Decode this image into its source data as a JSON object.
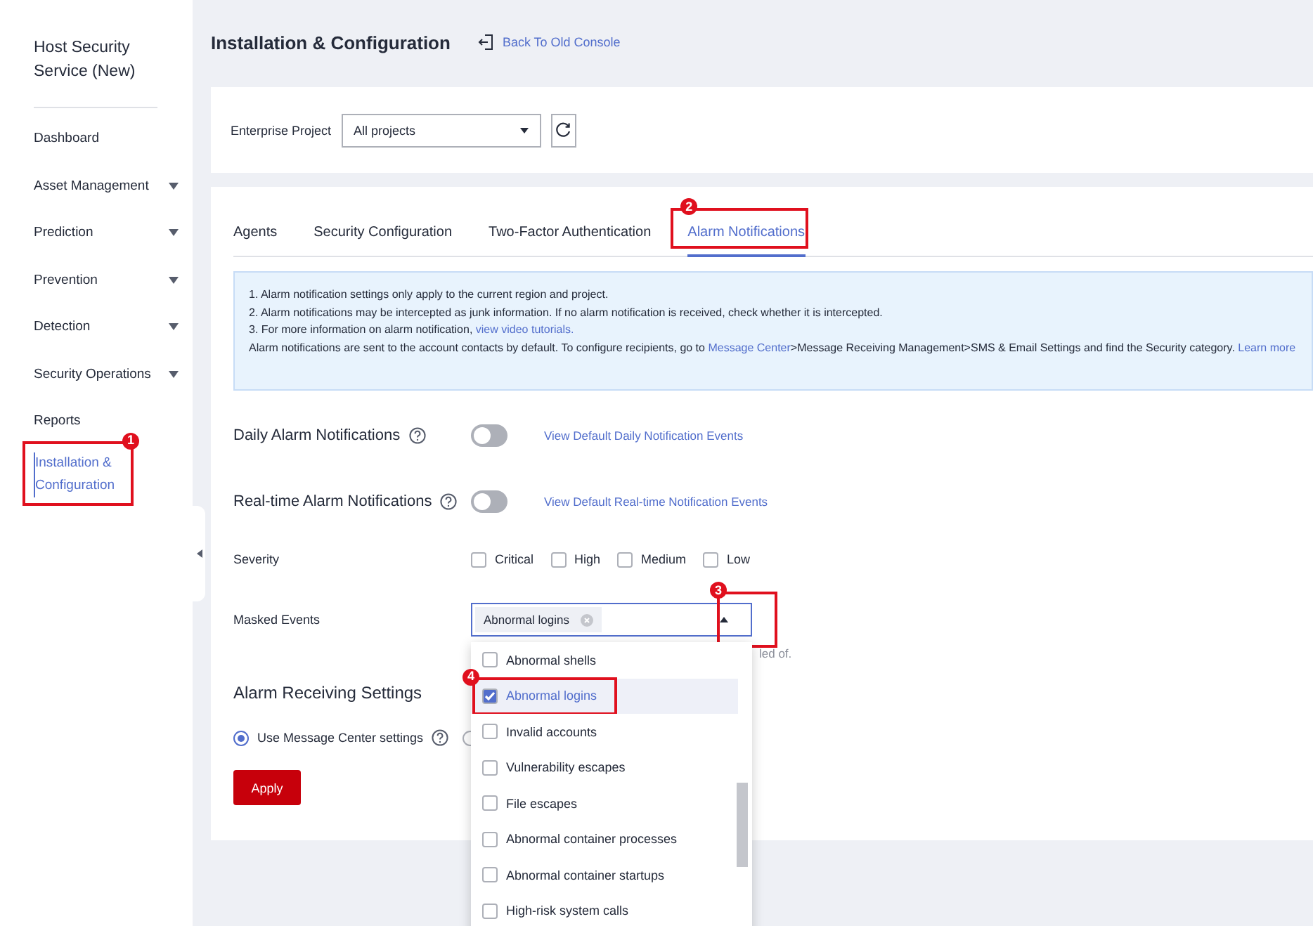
{
  "sidebar": {
    "title": "Host Security Service (New)",
    "items": [
      {
        "label": "Dashboard",
        "expandable": false,
        "selected": false
      },
      {
        "label": "Asset Management",
        "expandable": true,
        "selected": false
      },
      {
        "label": "Prediction",
        "expandable": true,
        "selected": false
      },
      {
        "label": "Prevention",
        "expandable": true,
        "selected": false
      },
      {
        "label": "Detection",
        "expandable": true,
        "selected": false
      },
      {
        "label": "Security Operations",
        "expandable": true,
        "selected": false
      },
      {
        "label": "Reports",
        "expandable": false,
        "selected": false
      },
      {
        "label": "Installation & Configuration",
        "expandable": false,
        "selected": true,
        "callout": "1"
      }
    ]
  },
  "header": {
    "title": "Installation & Configuration",
    "back_link": "Back To Old Console"
  },
  "project": {
    "label": "Enterprise Project",
    "value": "All projects"
  },
  "tabs": [
    {
      "label": "Agents",
      "selected": false
    },
    {
      "label": "Security Configuration",
      "selected": false
    },
    {
      "label": "Two-Factor Authentication",
      "selected": false
    },
    {
      "label": "Alarm Notifications",
      "selected": true,
      "callout": "2"
    }
  ],
  "notice": [
    {
      "text": "1. Alarm notification settings only apply to the current region and project."
    },
    {
      "text": "2. Alarm notifications may be intercepted as junk information. If no alarm notification is received, check whether it is intercepted."
    },
    {
      "text": "3. For more information on alarm notification, ",
      "link": "view video tutorials."
    },
    {
      "text": "Alarm notifications are sent to the account contacts by default. To configure recipients, go to ",
      "link": "Message Center",
      "after": ">Message Receiving Management>SMS & Email Settings and find the Security category. ",
      "link2": "Learn more"
    }
  ],
  "switches": [
    {
      "label": "Daily Alarm Notifications",
      "on": false,
      "link": "View Default Daily Notification Events"
    },
    {
      "label": "Real-time Alarm Notifications",
      "on": false,
      "link": "View Default Real-time Notification Events"
    }
  ],
  "severity": {
    "label": "Severity",
    "options": [
      {
        "label": "Critical",
        "checked": false
      },
      {
        "label": "High",
        "checked": false
      },
      {
        "label": "Medium",
        "checked": false
      },
      {
        "label": "Low",
        "checked": false
      }
    ]
  },
  "masked_events": {
    "label": "Masked Events",
    "tags": [
      "Abnormal logins"
    ],
    "expanded": true,
    "callout": "3",
    "hint": "led of.",
    "options": [
      {
        "label": "Abnormal shells",
        "checked": false
      },
      {
        "label": "Abnormal logins",
        "checked": true,
        "callout": "4"
      },
      {
        "label": "Invalid accounts",
        "checked": false
      },
      {
        "label": "Vulnerability escapes",
        "checked": false
      },
      {
        "label": "File escapes",
        "checked": false
      },
      {
        "label": "Abnormal container processes",
        "checked": false
      },
      {
        "label": "Abnormal container startups",
        "checked": false
      },
      {
        "label": "High-risk system calls",
        "checked": false
      }
    ]
  },
  "receiving": {
    "title": "Alarm Receiving Settings",
    "options": [
      {
        "label": "Use Message Center settings",
        "selected": true,
        "help": true
      },
      {
        "selected": false
      }
    ]
  },
  "apply_button": "Apply"
}
